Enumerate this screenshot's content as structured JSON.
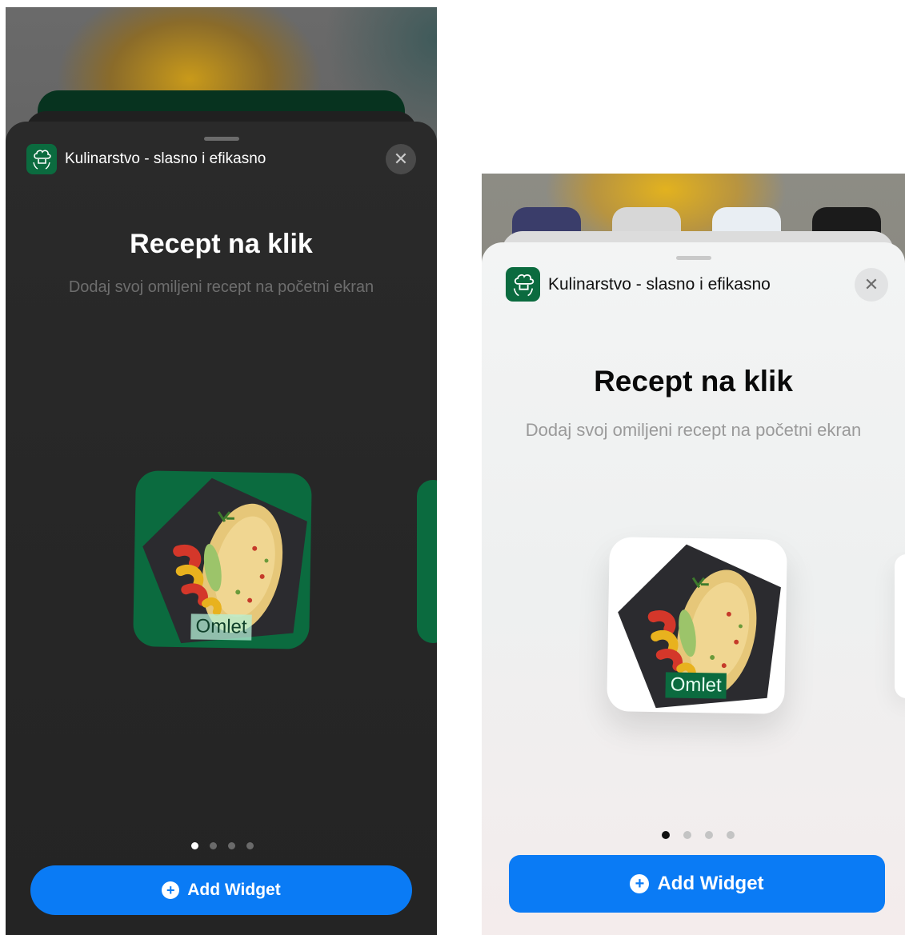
{
  "app": {
    "name": "Kulinarstvo - slasno i efikasno",
    "icon": "chef-hat-icon"
  },
  "widget": {
    "title": "Recept na klik",
    "description": "Dodaj svoj omiljeni recept na početni ekran",
    "preview_label": "Omlet",
    "page_count": 4,
    "current_page": 1
  },
  "actions": {
    "close_icon": "close-icon",
    "add_label": "Add Widget",
    "add_icon": "plus-circle-icon"
  },
  "colors": {
    "accent": "#0a7bf5",
    "brand_green": "#0b6b3f"
  }
}
